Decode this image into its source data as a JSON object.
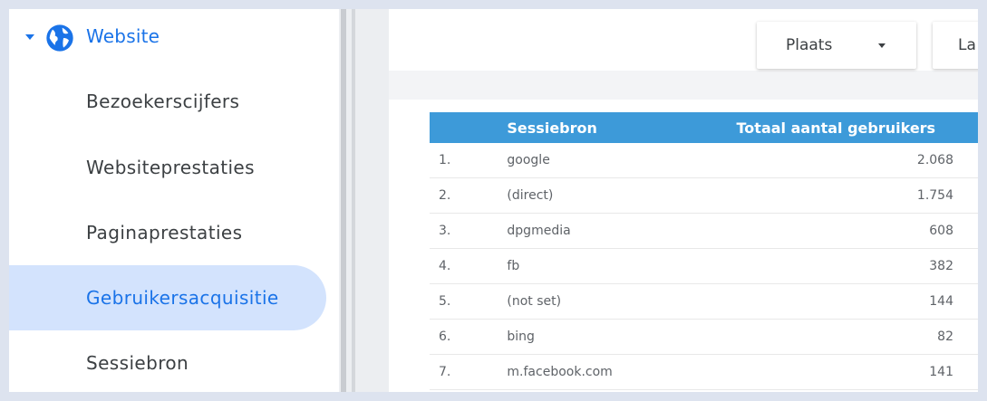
{
  "sidebar": {
    "section": "Website",
    "items": [
      {
        "label": "Bezoekerscijfers",
        "active": false
      },
      {
        "label": "Websiteprestaties",
        "active": false
      },
      {
        "label": "Paginaprestaties",
        "active": false
      },
      {
        "label": "Gebruikersacquisitie",
        "active": true
      },
      {
        "label": "Sessiebron",
        "active": false
      }
    ]
  },
  "toolbar": {
    "filter1": "Plaats",
    "filter2": "La"
  },
  "table": {
    "headers": [
      "Sessiebron",
      "Totaal aantal gebruikers"
    ],
    "rows": [
      {
        "idx": "1.",
        "source": "google",
        "users": "2.068"
      },
      {
        "idx": "2.",
        "source": "(direct)",
        "users": "1.754"
      },
      {
        "idx": "3.",
        "source": "dpgmedia",
        "users": "608"
      },
      {
        "idx": "4.",
        "source": "fb",
        "users": "382"
      },
      {
        "idx": "5.",
        "source": "(not set)",
        "users": "144"
      },
      {
        "idx": "6.",
        "source": "bing",
        "users": "82"
      },
      {
        "idx": "7.",
        "source": "m.facebook.com",
        "users": "141"
      }
    ]
  },
  "colors": {
    "accent": "#1a73e8",
    "active_bg": "#d3e3fd",
    "table_header": "#3d9ad9"
  }
}
